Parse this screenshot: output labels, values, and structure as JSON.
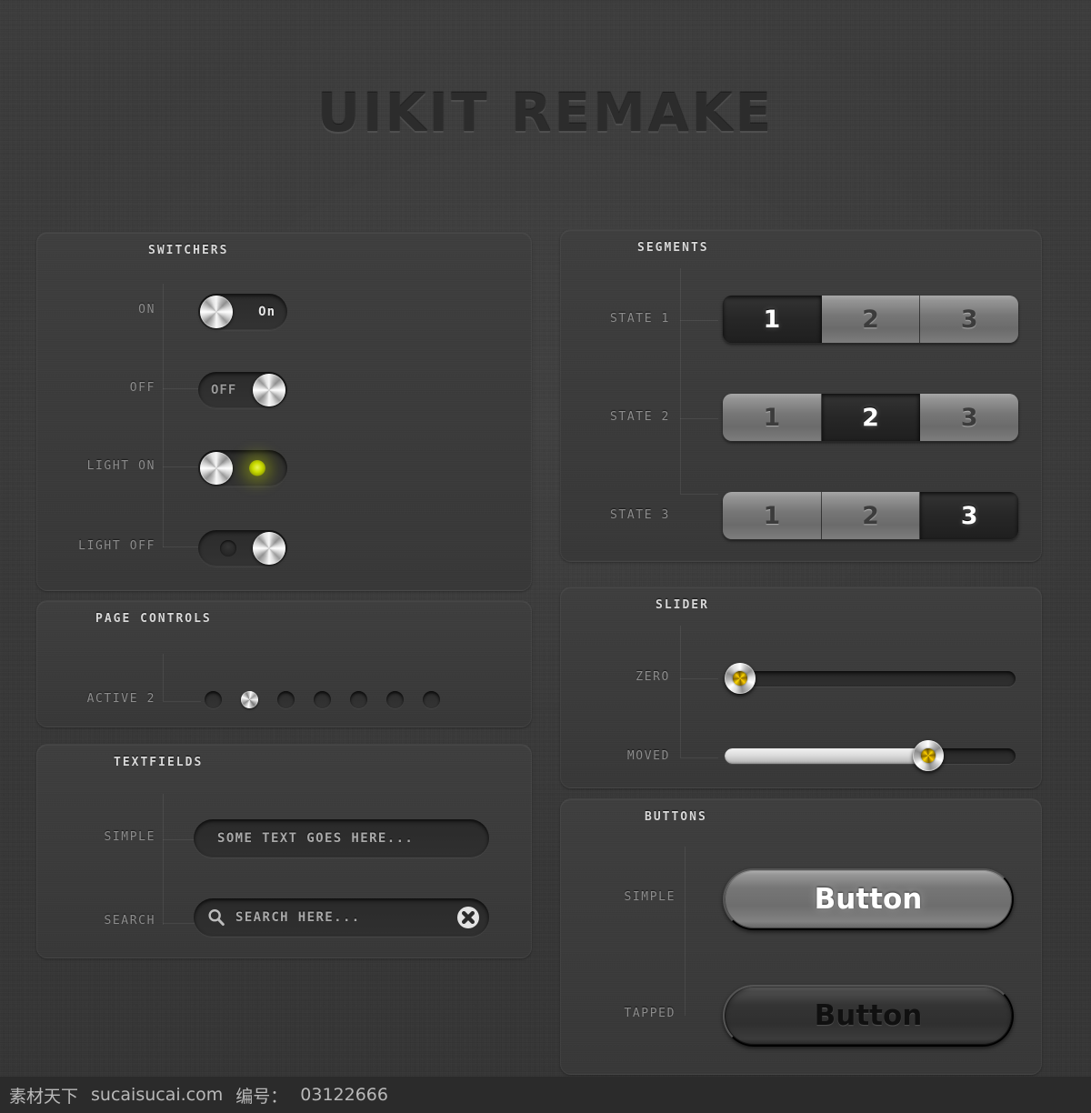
{
  "title": "UIKIT REMAKE",
  "panels": {
    "switchers": {
      "title": "SWITCHERS",
      "rows": [
        {
          "label": "ON",
          "state": "on",
          "text": "On"
        },
        {
          "label": "OFF",
          "state": "off",
          "text": "OFF"
        },
        {
          "label": "LIGHT ON",
          "state": "light-on",
          "text": ""
        },
        {
          "label": "LIGHT OFF",
          "state": "light-off",
          "text": ""
        }
      ]
    },
    "page_controls": {
      "title": "PAGE CONTROLS",
      "row_label": "ACTIVE 2",
      "total_dots": 7,
      "active_index": 2
    },
    "textfields": {
      "title": "TEXTFIELDS",
      "simple": {
        "label": "SIMPLE",
        "value": "SOME TEXT GOES HERE...",
        "placeholder": "SOME TEXT GOES HERE..."
      },
      "search": {
        "label": "SEARCH",
        "value": "SEARCH HERE...",
        "placeholder": "SEARCH HERE...",
        "search_icon": "magnifier-icon",
        "clear_icon": "clear-circle-icon"
      }
    },
    "segments": {
      "title": "SEGMENTS",
      "rows": [
        {
          "label": "STATE 1",
          "options": [
            "1",
            "2",
            "3"
          ],
          "selected": 0
        },
        {
          "label": "STATE 2",
          "options": [
            "1",
            "2",
            "3"
          ],
          "selected": 1
        },
        {
          "label": "STATE 3",
          "options": [
            "1",
            "2",
            "3"
          ],
          "selected": 2
        }
      ]
    },
    "slider": {
      "title": "SLIDER",
      "rows": [
        {
          "label": "ZERO",
          "value": 0
        },
        {
          "label": "MOVED",
          "value": 70
        }
      ]
    },
    "buttons": {
      "title": "BUTTONS",
      "rows": [
        {
          "label": "SIMPLE",
          "text": "Button",
          "state": "normal"
        },
        {
          "label": "TAPPED",
          "text": "Button",
          "state": "pressed"
        }
      ]
    }
  },
  "watermark": {
    "site_cn": "素材天下",
    "site_url": "sucaisucai.com",
    "id_label": "编号：",
    "id_value": "03122666"
  },
  "colors": {
    "background": "#3a3a3a",
    "panel": "#3e3e3e",
    "label": "#8d8d8d",
    "title": "#d8d8d8",
    "led_on": "#cadc00",
    "slider_core": "#ffd900",
    "metal_light": "#ffffff",
    "metal_dark": "#8a8a8a"
  }
}
